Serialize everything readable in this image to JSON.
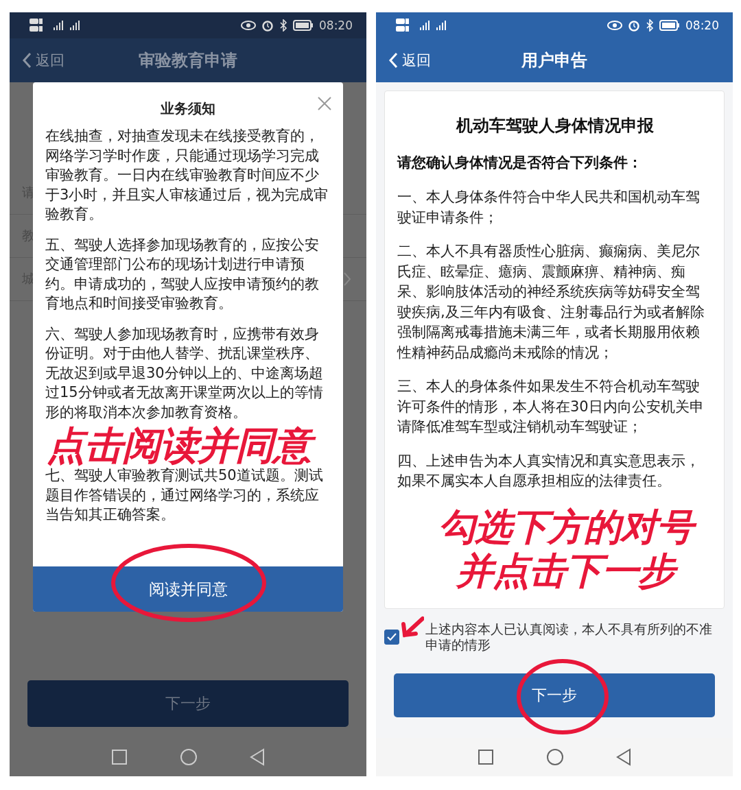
{
  "left_screen": {
    "status_bar": {
      "time": "08:20"
    },
    "header": {
      "back_label": "返回",
      "title": "审验教育申请"
    },
    "background_rows": [
      {
        "label": "请",
        "chevron": false
      },
      {
        "label": "教",
        "chevron": false
      },
      {
        "label": "城",
        "chevron": true
      }
    ],
    "dialog": {
      "title": "业务须知",
      "paragraphs": [
        "在线抽查，对抽查发现未在线接受教育的，网络学习学时作废，只能通过现场学习完成审验教育。一日内在线审验教育时间应不少于3小时，并且实人审核通过后，视为完成审验教育。",
        "五、驾驶人选择参加现场教育的，应按公安交通管理部门公布的现场计划进行申请预约。申请成功的，驾驶人应按申请预约的教育地点和时间接受审验教育。",
        "六、驾驶人参加现场教育时，应携带有效身份证明。对于由他人替学、扰乱课堂秩序、无故迟到或早退30分钟以上的、中途离场超过15分钟或者无故离开课堂两次以上的等情形的将取消本次参加教育资格。",
        "七、驾驶人审验教育测试共50道试题。测试题目作答错误的，通过网络学习的，系统应当告知其正确答案。"
      ],
      "confirm_button": "阅读并同意"
    },
    "annotation": "点击阅读并同意",
    "next_button": {
      "label": "下一步",
      "disabled": true
    }
  },
  "right_screen": {
    "status_bar": {
      "time": "08:20"
    },
    "header": {
      "back_label": "返回",
      "title": "用户申告"
    },
    "card": {
      "title": "机动车驾驶人身体情况申报",
      "subtitle": "请您确认身体情况是否符合下列条件：",
      "paragraphs": [
        "一、本人身体条件符合中华人民共和国机动车驾驶证申请条件；",
        "二、本人不具有器质性心脏病、癫痫病、美尼尔氏症、眩晕症、癔病、震颤麻痹、精神病、痴呆、影响肢体活动的神经系统疾病等妨碍安全驾驶疾病,及三年内有吸食、注射毒品行为或者解除强制隔离戒毒措施未满三年，或者长期服用依赖性精神药品成瘾尚未戒除的情况；",
        "三、本人的身体条件如果发生不符合机动车驾驶许可条件的情形，本人将在30日内向公安机关申请降低准驾车型或注销机动车驾驶证；",
        "四、上述申告为本人真实情况和真实意思表示，如果不属实本人自愿承担相应的法律责任。"
      ]
    },
    "annotations": [
      "勾选下方的对号",
      "并点击下一步"
    ],
    "agreement": {
      "checked": true,
      "label": "上述内容本人已认真阅读，本人不具有所列的不准申请的情形"
    },
    "next_button": {
      "label": "下一步",
      "disabled": false
    }
  }
}
